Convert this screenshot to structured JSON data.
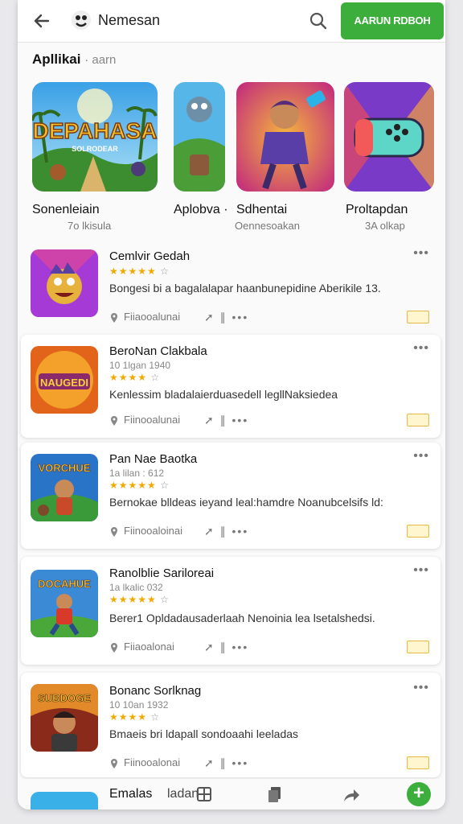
{
  "header": {
    "title": "Nemesan",
    "button_label": "AARUN RDBOH"
  },
  "section": {
    "title": "Apllikai",
    "subtitle": "· aarn"
  },
  "featured": [
    {
      "label": "Sonenleiain",
      "sub": "7o lkisula",
      "art_text": "DEPAHASA",
      "art_sub": "SOLRODEAR"
    },
    {
      "label": "Aplobva ·",
      "sub": ""
    },
    {
      "label": "Sdhentai",
      "sub": "Oennesoakan"
    },
    {
      "label": "Proltapdan",
      "sub": "3A olkap"
    }
  ],
  "list": [
    {
      "title": "Cemlvir Gedah",
      "sub": "",
      "stars": "★★★★★",
      "desc": "Bongesi bi a bagalalapar haanbunepidine Aberikile 13.",
      "location": "Fiiaooalunai"
    },
    {
      "title": "BeroNan Clakbala",
      "sub": "10 1lgan 1940",
      "stars": "★★★★",
      "desc": "Kenlessim bladalaierduasedell legllNaksiedea",
      "location": "Fiinooalunai",
      "art_text": "NAUGEDI"
    },
    {
      "title": "Pan Nae Baotka",
      "sub": "1a lilan : 612",
      "stars": "★★★★★",
      "desc": "Bernokae blldeas ieyand leal:hamdre Noanubcelsifs ld:",
      "location": "Fiinooaloinai",
      "art_text": "VORCHUE"
    },
    {
      "title": "Ranolblie Sariloreai",
      "sub": "1a lkalic 032",
      "stars": "★★★★★",
      "desc": "Berer1 Opldadausaderlaah Nenoinia lea lsetalshedsi.",
      "location": "Fiiaoalonai",
      "art_text": "DOCAHUE"
    },
    {
      "title": "Bonanc Sorlknag",
      "sub": "10 10an 1932",
      "stars": "★★★★",
      "desc": "Bmaeis bri ldapall sondoaahi leeladas",
      "location": "Fiinooalonai",
      "art_text": "SUBDOGE"
    }
  ],
  "bottom": {
    "partial_title": "Emalas",
    "tab_label": "ladan"
  },
  "colors": {
    "accent_green": "#3cae3c",
    "star_gold": "#f2a900"
  }
}
